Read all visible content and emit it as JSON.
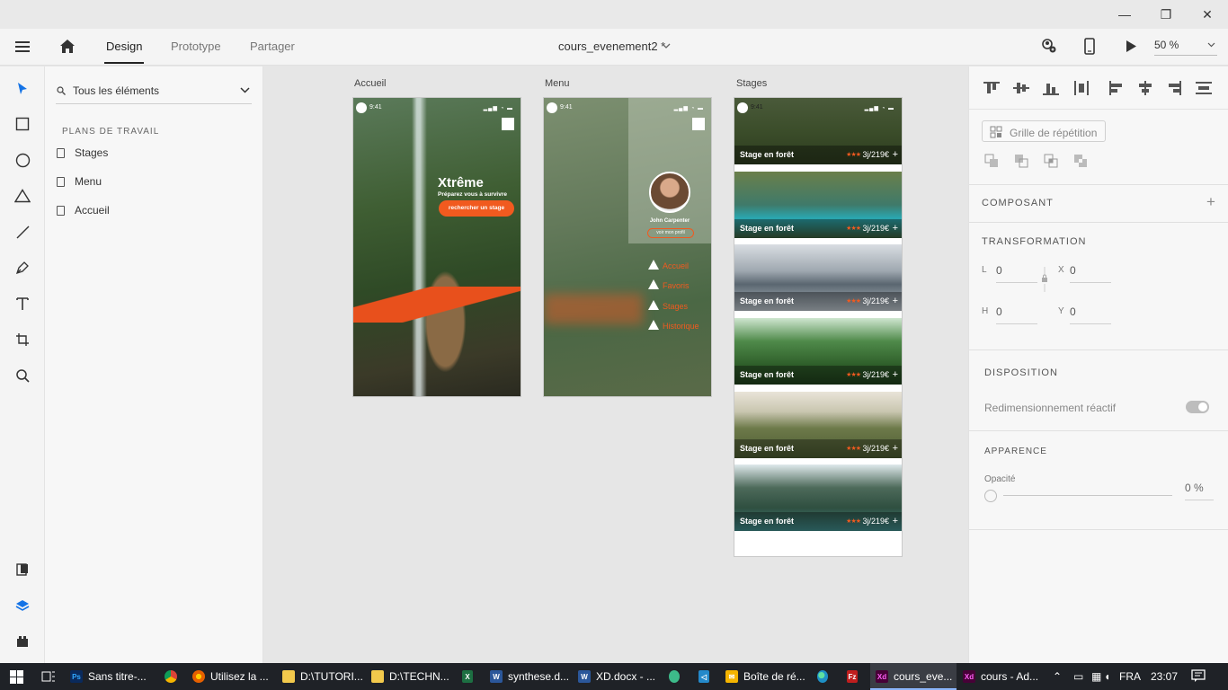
{
  "window": {
    "controls": [
      "—",
      "❐",
      "✕"
    ]
  },
  "toolbar": {
    "tabs": [
      "Design",
      "Prototype",
      "Partager"
    ],
    "document_name": "cours_evenement2 *",
    "zoom": "50 %",
    "icons": [
      "hamburger-menu-icon",
      "home-icon",
      "share-user-icon",
      "mobile-preview-icon",
      "play-icon",
      "chevron-down-icon"
    ]
  },
  "tools": [
    "select-arrow-icon",
    "rectangle-icon",
    "ellipse-icon",
    "triangle-icon",
    "line-icon",
    "pen-icon",
    "text-icon",
    "artboard-icon",
    "zoom-icon",
    "assets-icon",
    "layers-icon",
    "plugins-icon"
  ],
  "layers": {
    "search_label": "Tous les éléments",
    "section_title": "PLANS DE TRAVAIL",
    "items": [
      "Stages",
      "Menu",
      "Accueil"
    ]
  },
  "artboards": {
    "accueil": {
      "title": "Accueil",
      "time": "9:41",
      "heading": "Xtrême",
      "subheading": "Préparez vous à survivre",
      "button": "rechercher un stage"
    },
    "menu": {
      "title": "Menu",
      "time": "9:41",
      "name": "John Carpenter",
      "profile_button": "voir mon profil",
      "items": [
        "Accueil",
        "Favoris",
        "Stages",
        "Historique"
      ]
    },
    "stages": {
      "title": "Stages",
      "time": "9:41",
      "cards": [
        {
          "title": "Stage en forêt",
          "stars": "★★★",
          "price": "3j/219€"
        },
        {
          "title": "Stage en forêt",
          "stars": "★★★",
          "price": "3j/219€"
        },
        {
          "title": "Stage en forêt",
          "stars": "★★★",
          "price": "3j/219€"
        },
        {
          "title": "Stage en forêt",
          "stars": "★★★",
          "price": "3j/219€"
        },
        {
          "title": "Stage en forêt",
          "stars": "★★★",
          "price": "3j/219€"
        },
        {
          "title": "Stage en forêt",
          "stars": "★★★",
          "price": "3j/219€"
        }
      ]
    }
  },
  "properties": {
    "repeat_grid": "Grille de répétition",
    "component": "COMPOSANT",
    "transform": {
      "title": "TRANSFORMATION",
      "l_label": "L",
      "l_value": "0",
      "x_label": "X",
      "x_value": "0",
      "h_label": "H",
      "h_value": "0",
      "y_label": "Y",
      "y_value": "0"
    },
    "layout": {
      "title": "DISPOSITION",
      "responsive": "Redimensionnement réactif"
    },
    "appearance": {
      "title": "APPARENCE",
      "opacity_label": "Opacité",
      "opacity_value": "0 %"
    }
  },
  "taskbar": {
    "apps": [
      {
        "label": "Sans titre-...",
        "icon": "Ps",
        "color": "#0a2a5c"
      },
      {
        "label": "",
        "icon": "chrome",
        "color": "#e0e0e0"
      },
      {
        "label": "Utilisez la ...",
        "icon": "firefox",
        "color": "#e66000"
      },
      {
        "label": "D:\\TUTORI...",
        "icon": "folder",
        "color": "#f2c94c"
      },
      {
        "label": "D:\\TECHN...",
        "icon": "folder",
        "color": "#f2c94c"
      },
      {
        "label": "",
        "icon": "excel",
        "color": "#1d6f42"
      },
      {
        "label": "synthese.d...",
        "icon": "W",
        "color": "#2b579a"
      },
      {
        "label": "XD.docx - ...",
        "icon": "W",
        "color": "#2b579a"
      },
      {
        "label": "",
        "icon": "app",
        "color": "#3dbb8a"
      },
      {
        "label": "",
        "icon": "vscode",
        "color": "#2489ca"
      },
      {
        "label": "Boîte de ré...",
        "icon": "mail",
        "color": "#f4b400"
      },
      {
        "label": "",
        "icon": "edge",
        "color": "#1e90c6"
      },
      {
        "label": "",
        "icon": "Fz",
        "color": "#bf1e1e"
      },
      {
        "label": "cours_eve...",
        "icon": "Xd",
        "color": "#470137"
      },
      {
        "label": "cours - Ad...",
        "icon": "Xd",
        "color": "#470137"
      }
    ],
    "language": "FRA",
    "clock": "23:07"
  }
}
